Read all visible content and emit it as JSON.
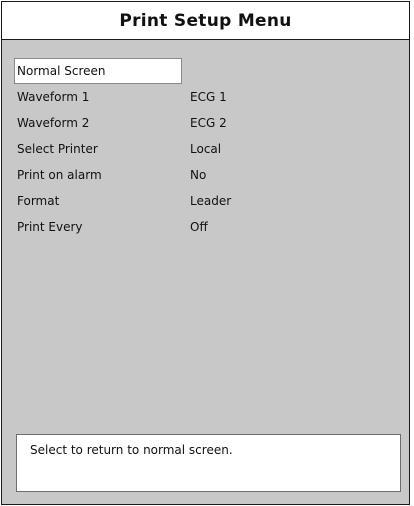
{
  "window": {
    "title": "Print Setup Menu"
  },
  "menu": {
    "items": [
      {
        "label": "Normal Screen",
        "value": ""
      },
      {
        "label": "Waveform 1",
        "value": "ECG 1"
      },
      {
        "label": "Waveform 2",
        "value": "ECG 2"
      },
      {
        "label": "Select Printer",
        "value": "Local"
      },
      {
        "label": "Print on alarm",
        "value": "No"
      },
      {
        "label": "Format",
        "value": "Leader"
      },
      {
        "label": "Print Every",
        "value": "Off"
      }
    ],
    "selected_index": 0
  },
  "help": {
    "text": "Select to return to normal screen."
  },
  "colors": {
    "panel_background": "#c8c8c8",
    "title_background": "#ffffff",
    "selection_background": "#ffffff",
    "border": "#1a1a1a"
  }
}
